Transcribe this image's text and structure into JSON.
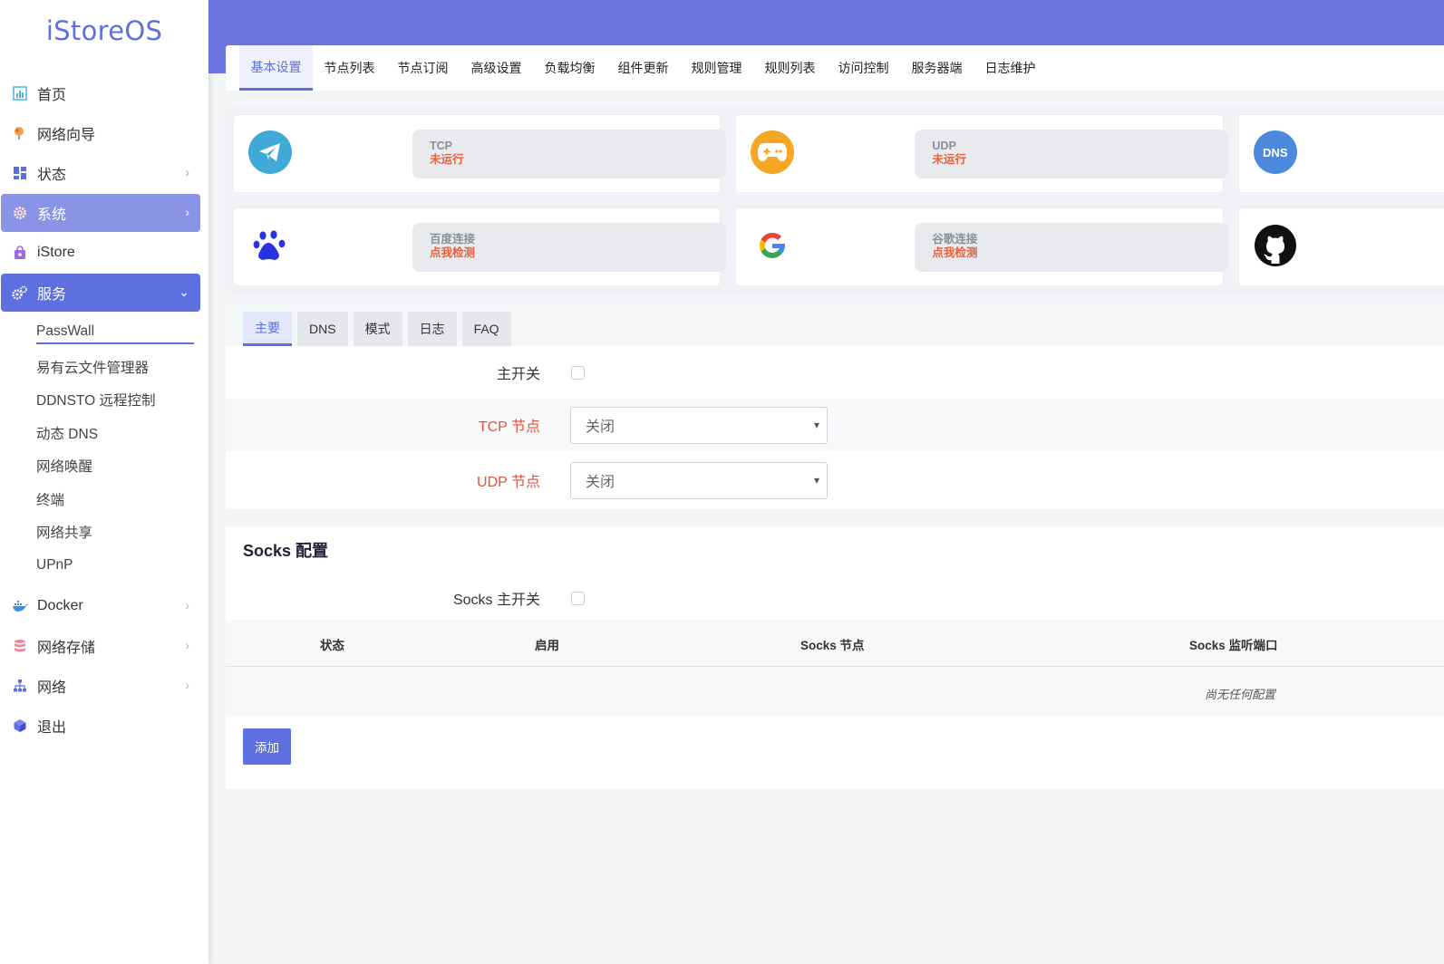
{
  "brand": {
    "name": "iStoreOS"
  },
  "sidebar": {
    "items": [
      {
        "label": "首页",
        "icon": "chart-icon"
      },
      {
        "label": "网络向导",
        "icon": "globe-icon"
      },
      {
        "label": "状态",
        "icon": "dashboard-icon"
      },
      {
        "label": "系统",
        "icon": "gear-icon"
      },
      {
        "label": "iStore",
        "icon": "bag-icon"
      },
      {
        "label": "服务",
        "icon": "cogs-icon"
      },
      {
        "label": "Docker",
        "icon": "docker-icon"
      },
      {
        "label": "网络存储",
        "icon": "database-icon"
      },
      {
        "label": "网络",
        "icon": "sitemap-icon"
      },
      {
        "label": "退出",
        "icon": "cube-icon"
      }
    ],
    "services_sub": [
      "PassWall",
      "易有云文件管理器",
      "DDNSTO 远程控制",
      "动态 DNS",
      "网络唤醒",
      "终端",
      "网络共享",
      "UPnP"
    ]
  },
  "tabs": [
    "基本设置",
    "节点列表",
    "节点订阅",
    "高级设置",
    "负载均衡",
    "组件更新",
    "规则管理",
    "规则列表",
    "访问控制",
    "服务器端",
    "日志维护"
  ],
  "status": {
    "tcp": {
      "label": "TCP",
      "value": "未运行"
    },
    "udp": {
      "label": "UDP",
      "value": "未运行"
    },
    "dns": {
      "icon_text": "DNS"
    },
    "baidu": {
      "label": "百度连接",
      "value": "点我检测"
    },
    "google": {
      "label": "谷歌连接",
      "value": "点我检测"
    }
  },
  "subtabs": [
    "主要",
    "DNS",
    "模式",
    "日志",
    "FAQ"
  ],
  "form": {
    "main_switch": "主开关",
    "tcp_node": {
      "label": "TCP 节点",
      "value": "关闭"
    },
    "udp_node": {
      "label": "UDP 节点",
      "value": "关闭"
    }
  },
  "socks": {
    "title": "Socks 配置",
    "main_switch": "Socks 主开关",
    "columns": [
      "状态",
      "启用",
      "Socks 节点",
      "Socks 监听端口"
    ],
    "empty": "尚无任何配置",
    "add_button": "添加"
  },
  "colors": {
    "accent": "#5e6fe0",
    "topbar": "#6a73e0",
    "warning": "#e8603c"
  }
}
